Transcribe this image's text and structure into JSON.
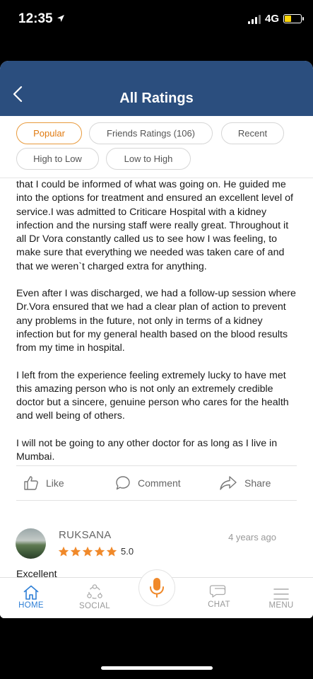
{
  "status_bar": {
    "time": "12:35",
    "network": "4G"
  },
  "header": {
    "title": "All Ratings"
  },
  "filters": [
    {
      "label": "Popular",
      "active": true
    },
    {
      "label": "Friends Ratings (106)",
      "active": false
    },
    {
      "label": "Recent",
      "active": false
    },
    {
      "label": "High to Low",
      "active": false
    },
    {
      "label": "Low to High",
      "active": false
    }
  ],
  "review": {
    "paragraphs": [
      "that I could be informed of what was going on. He guided me into the options for treatment and ensured an excellent level of service.I was admitted to Criticare Hospital with a kidney infection and the nursing staff were really great. Throughout it all Dr Vora constantly called us to see how I was feeling, to make sure that everything  we needed was taken care of and that we weren`t charged extra for anything.",
      "Even after I was discharged, we had a follow-up session where Dr.Vora ensured that we had a clear plan of action to prevent any problems in the future, not only in terms of a kidney infection but for my general health based on the blood results from my time in hospital.",
      "I left from the experience feeling extremely lucky to have met this amazing person who is not only an extremely credible doctor but a sincere, genuine person who cares for the health and well being of others.",
      "I will not be going to any other doctor for as long as I live in Mumbai."
    ],
    "actions": {
      "like": "Like",
      "comment": "Comment",
      "share": "Share"
    }
  },
  "review2": {
    "name": "RUKSANA",
    "time": "4 years ago",
    "rating": "5.0",
    "stars": 5,
    "text": "Excellent"
  },
  "tabbar": {
    "home": "HOME",
    "social": "SOCIAL",
    "chat": "CHAT",
    "menu": "MENU"
  },
  "colors": {
    "header_bg": "#2b4e7e",
    "accent_orange": "#e89a3c",
    "active_tab_blue": "#2e7fd6",
    "star_orange": "#f0892a"
  }
}
